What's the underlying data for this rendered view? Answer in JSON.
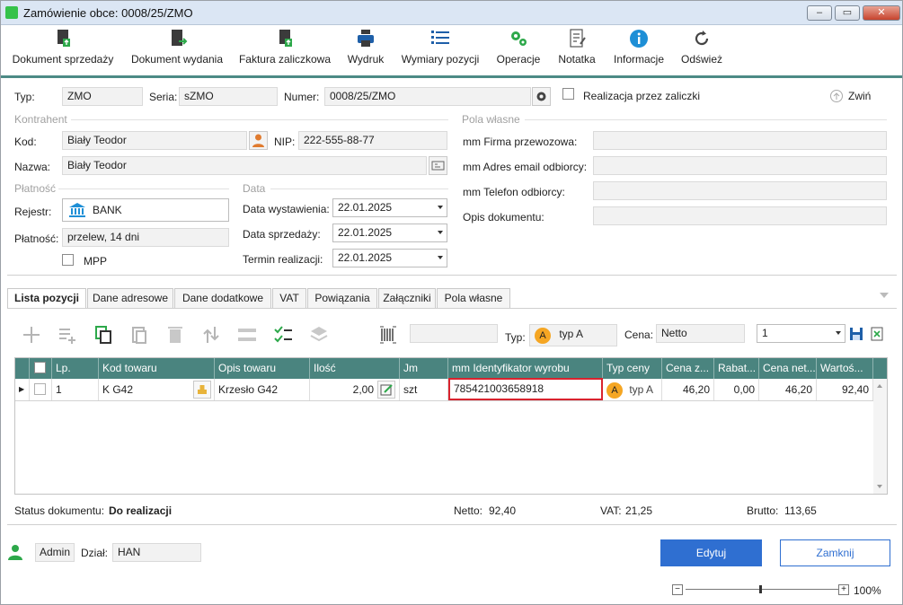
{
  "window": {
    "title": "Zamówienie obce: 0008/25/ZMO",
    "controls": [
      "–",
      "▭",
      "✕"
    ]
  },
  "toolbar": [
    {
      "label": "Dokument sprzedaży",
      "icon": "document-sale-icon"
    },
    {
      "label": "Dokument wydania",
      "icon": "document-issue-icon"
    },
    {
      "label": "Faktura zaliczkowa",
      "icon": "advance-invoice-icon"
    },
    {
      "label": "Wydruk",
      "icon": "printer-icon"
    },
    {
      "label": "Wymiary pozycji",
      "icon": "list-icon"
    },
    {
      "label": "Operacje",
      "icon": "gears-icon"
    },
    {
      "label": "Notatka",
      "icon": "note-icon"
    },
    {
      "label": "Informacje",
      "icon": "info-icon"
    },
    {
      "label": "Odśwież",
      "icon": "refresh-icon"
    }
  ],
  "header": {
    "typ_label": "Typ:",
    "typ_value": "ZMO",
    "seria_label": "Seria:",
    "seria_value": "sZMO",
    "numer_label": "Numer:",
    "numer_value": "0008/25/ZMO",
    "zaliczki_label": "Realizacja przez zaliczki",
    "collapse_label": "Zwiń"
  },
  "kontrahent": {
    "section": "Kontrahent",
    "kod_label": "Kod:",
    "kod_value": "Biały Teodor",
    "nip_label": "NIP:",
    "nip_value": "222-555-88-77",
    "nazwa_label": "Nazwa:",
    "nazwa_value": "Biały Teodor"
  },
  "platnosc": {
    "section": "Płatność",
    "rejestr_label": "Rejestr:",
    "rejestr_value": "BANK",
    "platnosc_label": "Płatność:",
    "platnosc_value": "przelew, 14 dni",
    "mpp_label": "MPP"
  },
  "data": {
    "section": "Data",
    "wystawienia_label": "Data wystawienia:",
    "wystawienia_value": "22.01.2025",
    "sprzedazy_label": "Data sprzedaży:",
    "sprzedazy_value": "22.01.2025",
    "termin_label": "Termin realizacji:",
    "termin_value": "22.01.2025"
  },
  "pola_wlasne": {
    "section": "Pola własne",
    "fields": [
      {
        "label": "mm Firma przewozowa:",
        "value": ""
      },
      {
        "label": "mm Adres email odbiorcy:",
        "value": ""
      },
      {
        "label": "mm Telefon odbiorcy:",
        "value": ""
      },
      {
        "label": "Opis dokumentu:",
        "value": ""
      }
    ]
  },
  "tabs": [
    "Lista pozycji",
    "Dane adresowe",
    "Dane dodatkowe",
    "VAT",
    "Powiązania",
    "Załączniki",
    "Pola własne"
  ],
  "positions_toolbar": {
    "search_value": "",
    "typ_label": "Typ:",
    "typ_badge": "A",
    "typ_value": "typ A",
    "cena_label": "Cena:",
    "cena_value": "Netto",
    "page_value": "1"
  },
  "grid": {
    "columns": [
      "Lp.",
      "Kod towaru",
      "Opis towaru",
      "Ilość",
      "Jm",
      "mm Identyfikator wyrobu",
      "Typ ceny",
      "Cena z...",
      "Rabat...",
      "Cena net...",
      "Wartoś..."
    ],
    "rows": [
      {
        "lp": "1",
        "kod": "K G42",
        "opis": "Krzesło G42",
        "ilosc": "2,00",
        "jm": "szt",
        "identyfikator": "785421003658918",
        "typ_badge": "A",
        "typ_ceny": "typ A",
        "cena_z": "46,20",
        "rabat": "0,00",
        "cena_net": "46,20",
        "wartosc": "92,40"
      }
    ]
  },
  "summary": {
    "status_label": "Status dokumentu:",
    "status_value": "Do realizacji",
    "netto_label": "Netto:",
    "netto_value": "92,40",
    "vat_label": "VAT:",
    "vat_value": "21,25",
    "brutto_label": "Brutto:",
    "brutto_value": "113,65"
  },
  "footer": {
    "user": "Admin",
    "dzial_label": "Dział:",
    "dzial_value": "HAN",
    "edit_label": "Edytuj",
    "close_label": "Zamknij",
    "zoom": "100%",
    "zoom_minus": "−",
    "zoom_plus": "+"
  },
  "colors": {
    "accent": "#4a847f",
    "primary": "#2f6fd1",
    "highlight": "#d9232e",
    "badge": "#f5a623"
  }
}
